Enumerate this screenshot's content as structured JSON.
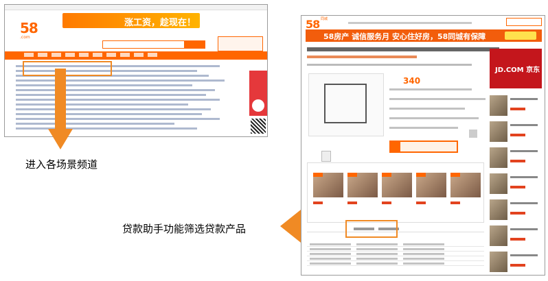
{
  "labels": {
    "enter_scene_channel": "进入各场景频道",
    "loan_assistant": "贷款助手功能筛选贷款产品"
  },
  "left_screenshot": {
    "logo": "58",
    "logo_domain": ".com",
    "banner_text": "涨工资，趁现在！"
  },
  "right_screenshot": {
    "logo": "58",
    "logo_subtitle": "同城",
    "banner_text": "58房产 诚信服务月  安心住好房，58同城有保障",
    "price": "340",
    "side_ad_text": "JD.COM 京东"
  },
  "colors": {
    "accent_orange": "#f08a24",
    "brand_orange": "#ff6600"
  }
}
